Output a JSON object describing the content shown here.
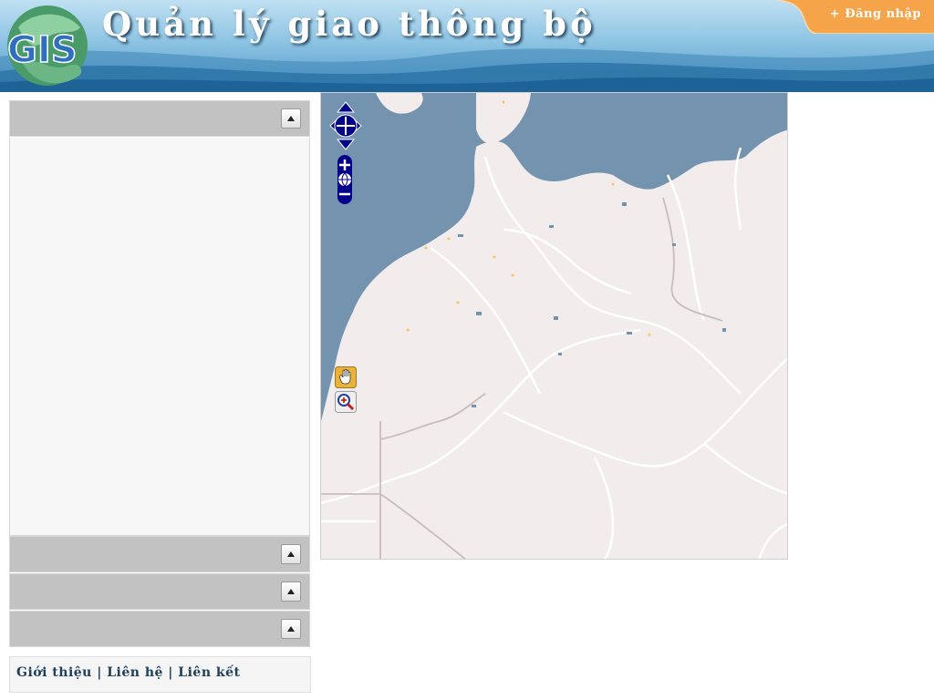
{
  "header": {
    "title": "Quản lý giao thông bộ",
    "login_label": "+ Đăng nhập",
    "logo_text": "GIS"
  },
  "colors": {
    "header_top": "#bfe0f2",
    "header_bottom": "#4e97c6",
    "login_tab": "#f5a44a",
    "panel_header": "#c2c2c2",
    "panel_body": "#f7f7f7",
    "map_land": "#f3ecec",
    "map_water": "#7393ae",
    "map_controls": "#00008b",
    "link_text": "#1d3f5c"
  },
  "sidebar": {
    "panels": [
      {
        "title": "",
        "expanded": true
      },
      {
        "title": "",
        "expanded": false
      },
      {
        "title": "",
        "expanded": false
      },
      {
        "title": "",
        "expanded": false
      }
    ]
  },
  "footer": {
    "links": [
      "Giới thiệu",
      "Liên hệ",
      "Liên kết"
    ],
    "separator": "|"
  },
  "map": {
    "controls": {
      "pan": [
        "pan-up-icon",
        "pan-left-icon",
        "pan-right-icon",
        "pan-down-icon"
      ],
      "zoom": [
        "zoom-in-icon",
        "zoom-world-icon",
        "zoom-out-icon"
      ],
      "tools": [
        "hand-pan-tool-icon",
        "zoom-box-tool-icon"
      ]
    }
  }
}
